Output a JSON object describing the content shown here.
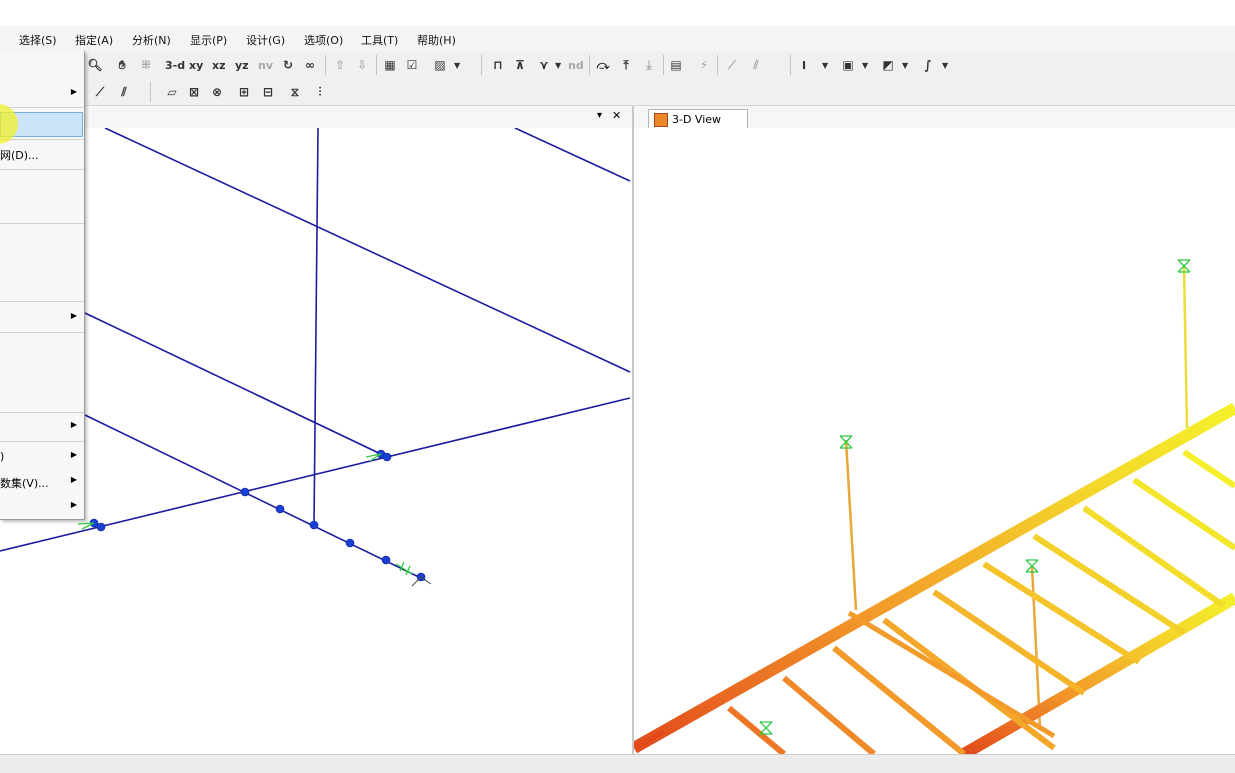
{
  "menubar": {
    "items": [
      "选择(S)",
      "指定(A)",
      "分析(N)",
      "显示(P)",
      "设计(G)",
      "选项(O)",
      "工具(T)",
      "帮助(H)"
    ]
  },
  "toolbar": {
    "view_3d": "3-d",
    "view_xy": "xy",
    "view_xz": "xz",
    "view_yz": "yz",
    "view_nv": "nv",
    "nd_label": "nd",
    "section_label": "I"
  },
  "dropdown": {
    "items": [
      {
        "label": "网(D)...",
        "has_submenu": false
      },
      {
        "label": ")",
        "has_submenu": true
      },
      {
        "label": "数集(V)...",
        "has_submenu": true
      }
    ]
  },
  "left_view": {
    "pin_icon": "▾",
    "close_icon": "✕"
  },
  "right_view": {
    "tab_label": "3-D View"
  },
  "colors": {
    "model_line": "#1c1c9e",
    "joint": "#1a3fd6",
    "support": "#2ecc40",
    "menu_highlight": "#cce4f7"
  }
}
